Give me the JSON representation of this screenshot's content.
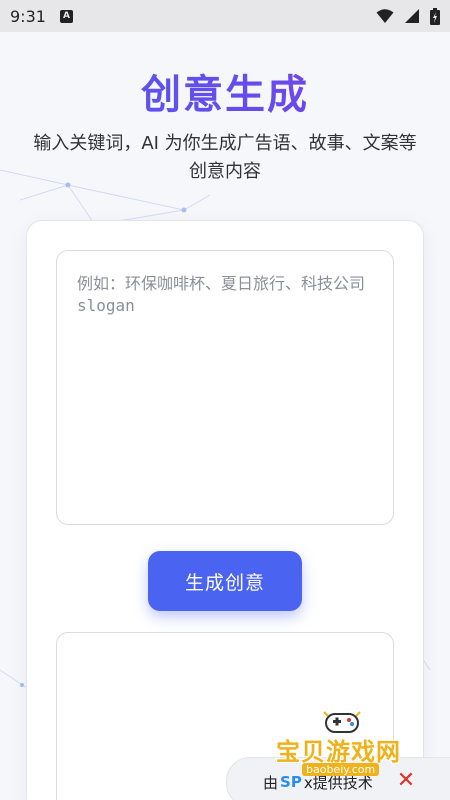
{
  "status_bar": {
    "time": "9:31",
    "app_icon": "A",
    "icons": [
      "wifi-icon",
      "signal-icon",
      "battery-icon"
    ]
  },
  "header": {
    "title": "创意生成",
    "subtitle": "输入关键词，AI 为你生成广告语、故事、文案等创意内容"
  },
  "form": {
    "prompt_placeholder": "例如：环保咖啡杯、夏日旅行、科技公司slogan",
    "prompt_value": "",
    "generate_label": "生成创意"
  },
  "result": {
    "text": ""
  },
  "footer": {
    "powered_prefix": "由",
    "powered_brand": "SP",
    "powered_suffix": "x提供技术",
    "close_symbol": "✕"
  },
  "watermark": {
    "name": "宝贝游戏网",
    "url": "baobeiy.com"
  },
  "colors": {
    "accent": "#4a63f0",
    "title_gradient_start": "#4f5bf0",
    "title_gradient_end": "#7a3fe8",
    "watermark": "#f0b21a",
    "close": "#e0312a"
  }
}
